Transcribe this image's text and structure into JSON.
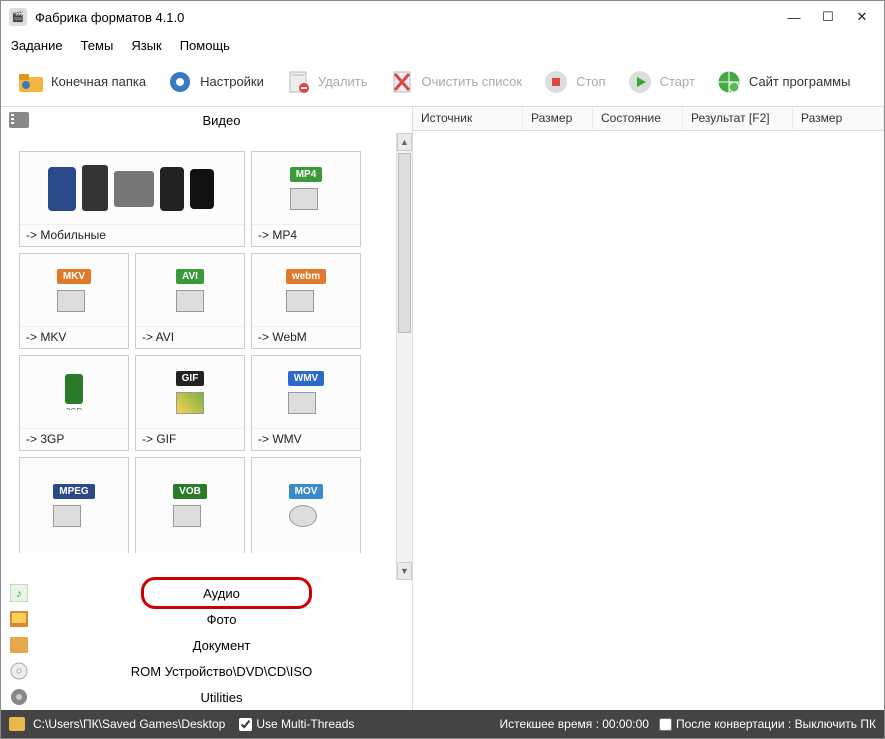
{
  "title": "Фабрика форматов 4.1.0",
  "menu": {
    "task": "Задание",
    "themes": "Темы",
    "lang": "Язык",
    "help": "Помощь"
  },
  "toolbar": {
    "outfolder": "Конечная папка",
    "settings": "Настройки",
    "delete": "Удалить",
    "clear": "Очистить список",
    "stop": "Стоп",
    "start": "Старт",
    "site": "Сайт программы"
  },
  "categories": {
    "video": "Видео",
    "audio": "Аудио",
    "photo": "Фото",
    "document": "Документ",
    "rom": "ROM Устройство\\DVD\\CD\\ISO",
    "utilities": "Utilities"
  },
  "tiles": {
    "mobile": "-> Мобильные",
    "mp4": "-> MP4",
    "mkv": "-> MKV",
    "avi": "-> AVI",
    "webm": "-> WebM",
    "3gp": "-> 3GP",
    "gif": "-> GIF",
    "wmv": "-> WMV"
  },
  "badges": {
    "mp4": "MP4",
    "mkv": "MKV",
    "avi": "AVI",
    "webm": "webm",
    "gif": "GIF",
    "wmv": "WMV",
    "mpeg": "MPEG",
    "vob": "VOB",
    "mov": "MOV"
  },
  "columns": {
    "source": "Источник",
    "size": "Размер",
    "state": "Состояние",
    "result": "Результат [F2]",
    "size2": "Размер"
  },
  "status": {
    "path": "C:\\Users\\ПК\\Saved Games\\Desktop",
    "multithread": "Use Multi-Threads",
    "elapsed": "Истекшее время : 00:00:00",
    "afterconv": "После конвертации : Выключить ПК"
  }
}
